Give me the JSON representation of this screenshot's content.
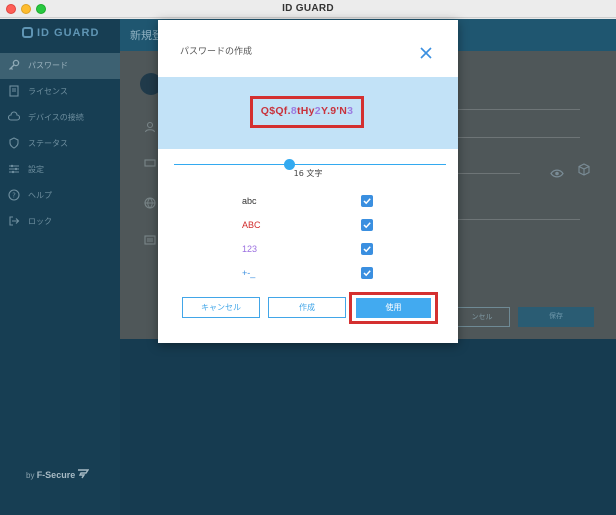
{
  "window": {
    "title": "ID GUARD"
  },
  "sidebar": {
    "logo": "ID GUARD",
    "items": [
      {
        "label": "パスワード",
        "icon": "key-icon",
        "active": true
      },
      {
        "label": "ライセンス",
        "icon": "license-icon"
      },
      {
        "label": "デバイスの接続",
        "icon": "cloud-sync-icon"
      },
      {
        "label": "ステータス",
        "icon": "shield-icon"
      },
      {
        "label": "設定",
        "icon": "sliders-icon"
      },
      {
        "label": "ヘルプ",
        "icon": "help-icon"
      },
      {
        "label": "ロック",
        "icon": "lock-exit-icon"
      }
    ],
    "footer_by": "by",
    "footer_brand": "F-Secure"
  },
  "main": {
    "header_title": "新規登",
    "cancel_label": "ンセル",
    "save_label": "保存"
  },
  "modal": {
    "title": "パスワードの作成",
    "password_segments": [
      {
        "text": "Q$Qf",
        "color": "#c8323c"
      },
      {
        "text": ".",
        "color": "#c8323c"
      },
      {
        "text": "8",
        "color": "#9b7ce0"
      },
      {
        "text": "tHy",
        "color": "#c8323c"
      },
      {
        "text": "2",
        "color": "#9b7ce0"
      },
      {
        "text": "Y.9'N",
        "color": "#c8323c"
      },
      {
        "text": "3",
        "color": "#9b7ce0"
      }
    ],
    "length": 16,
    "length_label": "16 文字",
    "options": [
      {
        "label": "abc",
        "color": "#333333",
        "checked": true
      },
      {
        "label": "ABC",
        "color": "#d12c2c",
        "checked": true
      },
      {
        "label": "123",
        "color": "#9b6fe0",
        "checked": true
      },
      {
        "label": "+-_",
        "color": "#3a8fe0",
        "checked": true
      }
    ],
    "cancel_label": "キャンセル",
    "create_label": "作成",
    "use_label": "使用"
  },
  "colors": {
    "accent": "#42aaf0",
    "highlight_red": "#d43030",
    "sidebar": "#173e53"
  }
}
